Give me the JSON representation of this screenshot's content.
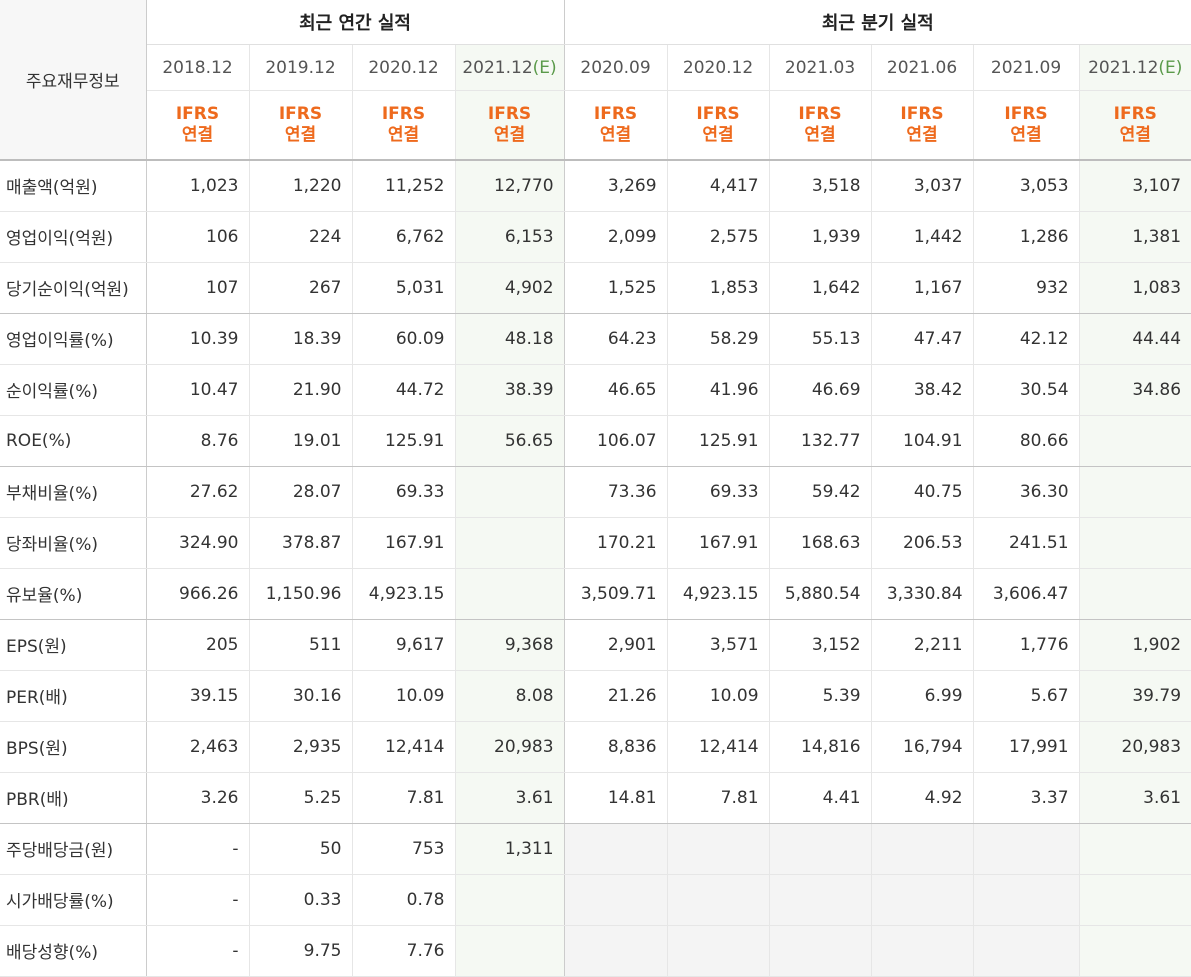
{
  "header": {
    "corner": "주요재무정보",
    "annual_title": "최근 연간 실적",
    "quarterly_title": "최근 분기 실적",
    "basis_top": "IFRS",
    "basis_bottom": "연결",
    "est_mark": "(E)"
  },
  "annual_periods": [
    "2018.12",
    "2019.12",
    "2020.12",
    "2021.12"
  ],
  "quarterly_periods": [
    "2020.09",
    "2020.12",
    "2021.03",
    "2021.06",
    "2021.09",
    "2021.12"
  ],
  "rows": [
    {
      "label": "매출액(억원)",
      "annual": [
        "1,023",
        "1,220",
        "11,252",
        "12,770"
      ],
      "quarterly": [
        "3,269",
        "4,417",
        "3,518",
        "3,037",
        "3,053",
        "3,107"
      ]
    },
    {
      "label": "영업이익(억원)",
      "annual": [
        "106",
        "224",
        "6,762",
        "6,153"
      ],
      "quarterly": [
        "2,099",
        "2,575",
        "1,939",
        "1,442",
        "1,286",
        "1,381"
      ]
    },
    {
      "label": "당기순이익(억원)",
      "annual": [
        "107",
        "267",
        "5,031",
        "4,902"
      ],
      "quarterly": [
        "1,525",
        "1,853",
        "1,642",
        "1,167",
        "932",
        "1,083"
      ]
    },
    {
      "label": "영업이익률(%)",
      "annual": [
        "10.39",
        "18.39",
        "60.09",
        "48.18"
      ],
      "quarterly": [
        "64.23",
        "58.29",
        "55.13",
        "47.47",
        "42.12",
        "44.44"
      ]
    },
    {
      "label": "순이익률(%)",
      "annual": [
        "10.47",
        "21.90",
        "44.72",
        "38.39"
      ],
      "quarterly": [
        "46.65",
        "41.96",
        "46.69",
        "38.42",
        "30.54",
        "34.86"
      ]
    },
    {
      "label": "ROE(%)",
      "annual": [
        "8.76",
        "19.01",
        "125.91",
        "56.65"
      ],
      "quarterly": [
        "106.07",
        "125.91",
        "132.77",
        "104.91",
        "80.66",
        ""
      ]
    },
    {
      "label": "부채비율(%)",
      "annual": [
        "27.62",
        "28.07",
        "69.33",
        ""
      ],
      "quarterly": [
        "73.36",
        "69.33",
        "59.42",
        "40.75",
        "36.30",
        ""
      ]
    },
    {
      "label": "당좌비율(%)",
      "annual": [
        "324.90",
        "378.87",
        "167.91",
        ""
      ],
      "quarterly": [
        "170.21",
        "167.91",
        "168.63",
        "206.53",
        "241.51",
        ""
      ]
    },
    {
      "label": "유보율(%)",
      "annual": [
        "966.26",
        "1,150.96",
        "4,923.15",
        ""
      ],
      "quarterly": [
        "3,509.71",
        "4,923.15",
        "5,880.54",
        "3,330.84",
        "3,606.47",
        ""
      ]
    },
    {
      "label": "EPS(원)",
      "annual": [
        "205",
        "511",
        "9,617",
        "9,368"
      ],
      "quarterly": [
        "2,901",
        "3,571",
        "3,152",
        "2,211",
        "1,776",
        "1,902"
      ]
    },
    {
      "label": "PER(배)",
      "annual": [
        "39.15",
        "30.16",
        "10.09",
        "8.08"
      ],
      "quarterly": [
        "21.26",
        "10.09",
        "5.39",
        "6.99",
        "5.67",
        "39.79"
      ]
    },
    {
      "label": "BPS(원)",
      "annual": [
        "2,463",
        "2,935",
        "12,414",
        "20,983"
      ],
      "quarterly": [
        "8,836",
        "12,414",
        "14,816",
        "16,794",
        "17,991",
        "20,983"
      ]
    },
    {
      "label": "PBR(배)",
      "annual": [
        "3.26",
        "5.25",
        "7.81",
        "3.61"
      ],
      "quarterly": [
        "14.81",
        "7.81",
        "4.41",
        "4.92",
        "3.37",
        "3.61"
      ]
    },
    {
      "label": "주당배당금(원)",
      "annual": [
        "-",
        "50",
        "753",
        "1,311"
      ],
      "quarterly": [
        "",
        "",
        "",
        "",
        "",
        ""
      ]
    },
    {
      "label": "시가배당률(%)",
      "annual": [
        "-",
        "0.33",
        "0.78",
        ""
      ],
      "quarterly": [
        "",
        "",
        "",
        "",
        "",
        ""
      ]
    },
    {
      "label": "배당성향(%)",
      "annual": [
        "-",
        "9.75",
        "7.76",
        ""
      ],
      "quarterly": [
        "",
        "",
        "",
        "",
        "",
        ""
      ]
    }
  ],
  "colors": {
    "ifrs": "#ee6a1d",
    "estimate_bg": "#f5f9f3",
    "estimate_mark": "#5a9a4a"
  }
}
